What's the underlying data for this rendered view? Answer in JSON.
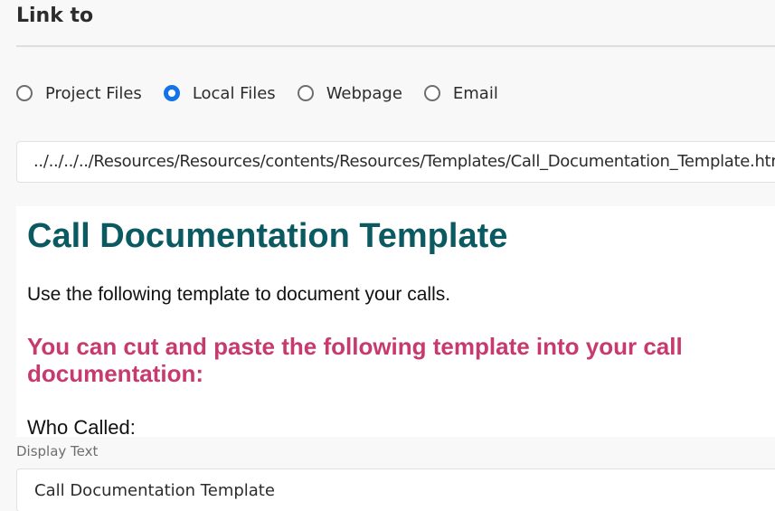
{
  "header": {
    "title": "Link to"
  },
  "link_type": {
    "options": [
      {
        "label": "Project Files",
        "checked": false
      },
      {
        "label": "Local Files",
        "checked": true
      },
      {
        "label": "Webpage",
        "checked": false
      },
      {
        "label": "Email",
        "checked": false
      }
    ]
  },
  "path_field": {
    "value": "../../../../Resources/Resources/contents/Resources/Templates/Call_Documentation_Template.html"
  },
  "preview": {
    "title": "Call Documentation Template",
    "intro": "Use the following template to document your calls.",
    "subheading": "You can cut and paste the following template into your call documentation:",
    "who_called": "Who Called:"
  },
  "display_text": {
    "label": "Display Text",
    "value": "Call Documentation Template"
  },
  "colors": {
    "accent": "#1473e6",
    "preview_title": "#0b5a61",
    "preview_subheading": "#c73a6d"
  }
}
